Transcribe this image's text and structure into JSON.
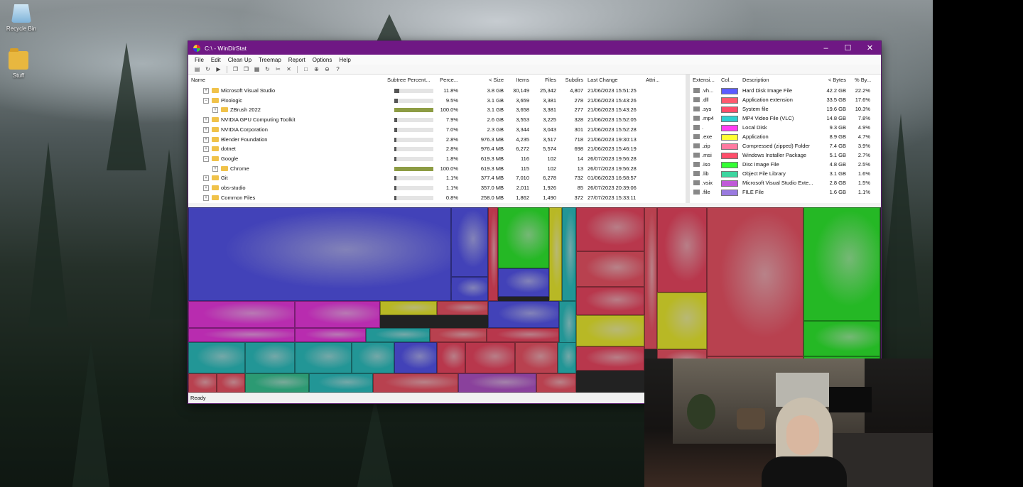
{
  "desktop": {
    "icons": [
      {
        "label": "Recycle Bin",
        "icon": "recycle-bin-icon"
      },
      {
        "label": "Stuff",
        "icon": "folder-icon"
      }
    ]
  },
  "window": {
    "title": "C:\\ - WinDirStat",
    "controls": {
      "minimize": "–",
      "maximize": "☐",
      "close": "✕"
    },
    "menu": [
      "File",
      "Edit",
      "Clean Up",
      "Treemap",
      "Report",
      "Options",
      "Help"
    ],
    "toolbar_icons": [
      "open-icon",
      "refresh-icon",
      "play-icon",
      "copy-icon",
      "copy-icon",
      "properties-icon",
      "refresh-icon",
      "clean-icon",
      "delete-icon",
      "blank-icon",
      "zoom-in-icon",
      "zoom-out-icon",
      "help-icon"
    ],
    "tree": {
      "columns": [
        "Name",
        "Subtree Percent...",
        "Perce...",
        "< Size",
        "Items",
        "Files",
        "Subdirs",
        "Last Change",
        "Attri..."
      ],
      "rows": [
        {
          "name": "Microsoft Visual Studio",
          "indent": 1,
          "expander": "+",
          "bar": 0.12,
          "percent": "11.8%",
          "size": "3.8 GB",
          "items": "30,149",
          "files": "25,342",
          "subdirs": "4,807",
          "last_change": "21/06/2023 15:51:25"
        },
        {
          "name": "Pixologic",
          "indent": 1,
          "expander": "−",
          "bar": 0.095,
          "percent": "9.5%",
          "size": "3.1 GB",
          "items": "3,659",
          "files": "3,381",
          "subdirs": "278",
          "last_change": "21/06/2023 15:43:26"
        },
        {
          "name": "ZBrush 2022",
          "indent": 2,
          "expander": "+",
          "bar": 1.0,
          "percent": "100.0%",
          "size": "3.1 GB",
          "items": "3,658",
          "files": "3,381",
          "subdirs": "277",
          "last_change": "21/06/2023 15:43:26"
        },
        {
          "name": "NVIDIA GPU Computing Toolkit",
          "indent": 1,
          "expander": "+",
          "bar": 0.079,
          "percent": "7.9%",
          "size": "2.6 GB",
          "items": "3,553",
          "files": "3,225",
          "subdirs": "328",
          "last_change": "21/06/2023 15:52:05"
        },
        {
          "name": "NVIDIA Corporation",
          "indent": 1,
          "expander": "+",
          "bar": 0.07,
          "percent": "7.0%",
          "size": "2.3 GB",
          "items": "3,344",
          "files": "3,043",
          "subdirs": "301",
          "last_change": "21/06/2023 15:52:28"
        },
        {
          "name": "Blender Foundation",
          "indent": 1,
          "expander": "+",
          "bar": 0.028,
          "percent": "2.8%",
          "size": "976.3 MB",
          "items": "4,235",
          "files": "3,517",
          "subdirs": "718",
          "last_change": "21/06/2023 19:30:13"
        },
        {
          "name": "dotnet",
          "indent": 1,
          "expander": "+",
          "bar": 0.028,
          "percent": "2.8%",
          "size": "976.4 MB",
          "items": "6,272",
          "files": "5,574",
          "subdirs": "698",
          "last_change": "21/06/2023 15:46:19"
        },
        {
          "name": "Google",
          "indent": 1,
          "expander": "−",
          "bar": 0.018,
          "percent": "1.8%",
          "size": "619.3 MB",
          "items": "116",
          "files": "102",
          "subdirs": "14",
          "last_change": "26/07/2023 19:56:28"
        },
        {
          "name": "Chrome",
          "indent": 2,
          "expander": "+",
          "bar": 1.0,
          "percent": "100.0%",
          "size": "619.3 MB",
          "items": "115",
          "files": "102",
          "subdirs": "13",
          "last_change": "26/07/2023 19:56:28"
        },
        {
          "name": "Git",
          "indent": 1,
          "expander": "+",
          "bar": 0.011,
          "percent": "1.1%",
          "size": "377.4 MB",
          "items": "7,010",
          "files": "6,278",
          "subdirs": "732",
          "last_change": "01/06/2023 16:58:57"
        },
        {
          "name": "obs-studio",
          "indent": 1,
          "expander": "+",
          "bar": 0.011,
          "percent": "1.1%",
          "size": "357.0 MB",
          "items": "2,011",
          "files": "1,926",
          "subdirs": "85",
          "last_change": "26/07/2023 20:39:06"
        },
        {
          "name": "Common Files",
          "indent": 1,
          "expander": "+",
          "bar": 0.008,
          "percent": "0.8%",
          "size": "258.0 MB",
          "items": "1,862",
          "files": "1,490",
          "subdirs": "372",
          "last_change": "27/07/2023 15:33:11"
        }
      ]
    },
    "extensions": {
      "columns": [
        "Extensi...",
        "Col...",
        "Description",
        "< Bytes",
        "% By..."
      ],
      "rows": [
        {
          "ext": ".vh...",
          "color": "#5b5bff",
          "description": "Hard Disk Image File",
          "bytes": "42.2 GB",
          "pct": "22.2%"
        },
        {
          "ext": ".dll",
          "color": "#ff5a6e",
          "description": "Application extension",
          "bytes": "33.5 GB",
          "pct": "17.6%"
        },
        {
          "ext": ".sys",
          "color": "#ff4d6a",
          "description": "System file",
          "bytes": "19.6 GB",
          "pct": "10.3%"
        },
        {
          "ext": ".mp4",
          "color": "#2fd0d0",
          "description": "MP4 Video File (VLC)",
          "bytes": "14.8 GB",
          "pct": "7.8%"
        },
        {
          "ext": ".",
          "color": "#ff3df3",
          "description": "Local Disk",
          "bytes": "9.3 GB",
          "pct": "4.9%"
        },
        {
          "ext": ".exe",
          "color": "#ffff33",
          "description": "Application",
          "bytes": "8.9 GB",
          "pct": "4.7%"
        },
        {
          "ext": ".zip",
          "color": "#ff7aa0",
          "description": "Compressed (zipped) Folder",
          "bytes": "7.4 GB",
          "pct": "3.9%"
        },
        {
          "ext": ".msi",
          "color": "#ff4d6a",
          "description": "Windows Installer Package",
          "bytes": "5.1 GB",
          "pct": "2.7%"
        },
        {
          "ext": ".iso",
          "color": "#33ff33",
          "description": "Disc Image File",
          "bytes": "4.8 GB",
          "pct": "2.5%"
        },
        {
          "ext": ".lib",
          "color": "#3dd6a0",
          "description": "Object File Library",
          "bytes": "3.1 GB",
          "pct": "1.6%"
        },
        {
          "ext": ".vsix",
          "color": "#c05ad8",
          "description": "Microsoft Visual Studio Exte...",
          "bytes": "2.8 GB",
          "pct": "1.5%"
        },
        {
          "ext": ".file",
          "color": "#9a7ae0",
          "description": "FILE File",
          "bytes": "1.6 GB",
          "pct": "1.1%"
        }
      ]
    },
    "status": "Ready"
  }
}
